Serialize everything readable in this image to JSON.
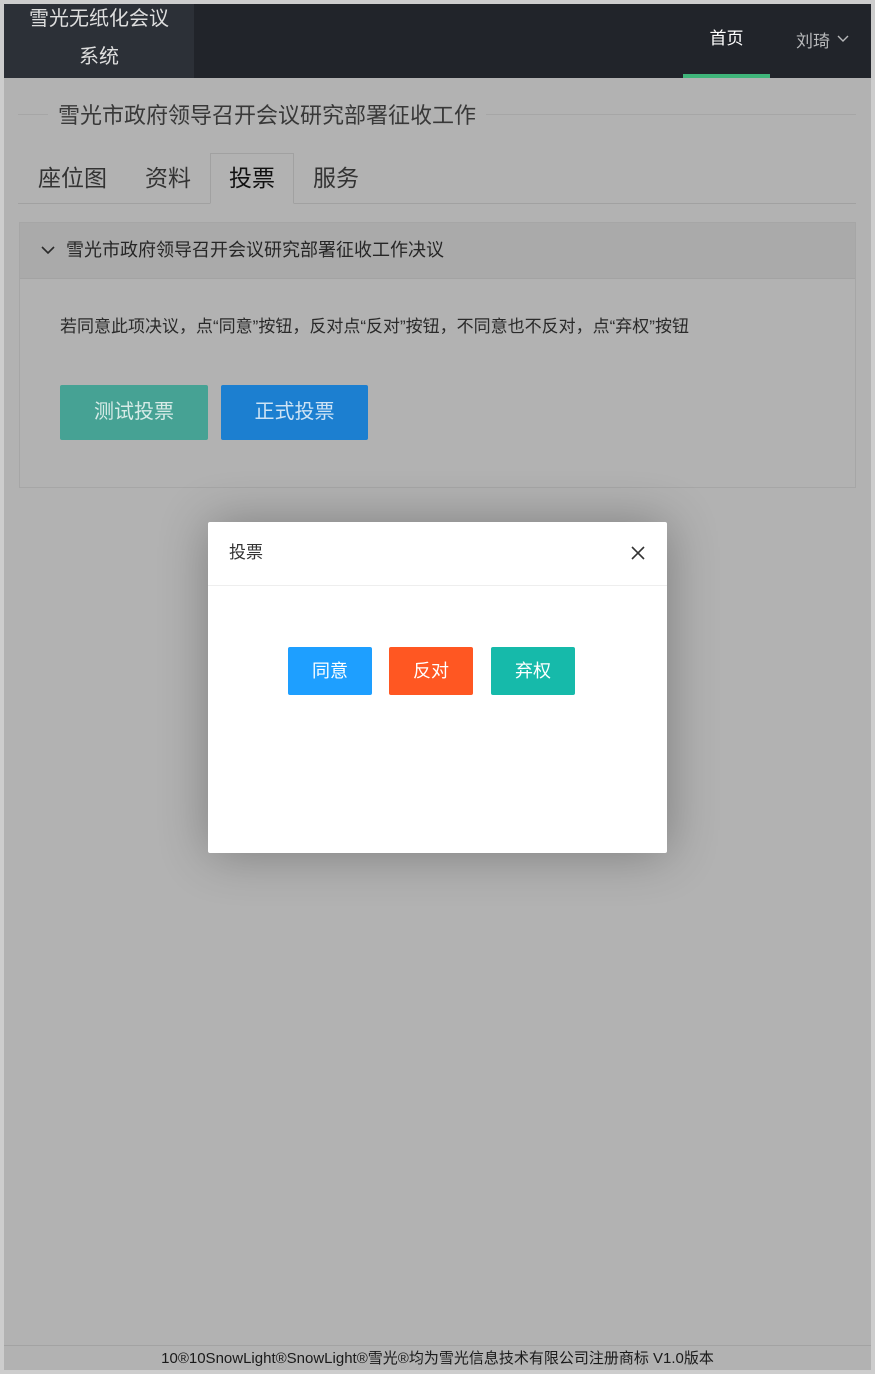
{
  "app": {
    "logo_text": "雪光无纸化会议系统"
  },
  "header": {
    "nav_home_label": "首页",
    "user_name": "刘琦",
    "user_menu_icon": "chevron-down-icon"
  },
  "meeting": {
    "title": "雪光市政府领导召开会议研究部署征收工作"
  },
  "tabs": [
    {
      "label": "座位图",
      "active": false
    },
    {
      "label": "资料",
      "active": false
    },
    {
      "label": "投票",
      "active": true
    },
    {
      "label": "服务",
      "active": false
    }
  ],
  "resolution": {
    "title": "雪光市政府领导召开会议研究部署征收工作决议",
    "expanded": true,
    "toggle_icon": "chevron-down-icon",
    "instruction": "若同意此项决议，点“同意”按钮，反对点“反对”按钮，不同意也不反对，点“弃权”按钮",
    "test_vote_label": "测试投票",
    "formal_vote_label": "正式投票"
  },
  "vote_dialog": {
    "title": "投票",
    "close_icon": "close-icon",
    "agree_label": "同意",
    "oppose_label": "反对",
    "abstain_label": "弃权"
  },
  "footer": {
    "text": "10®10SnowLight®SnowLight®雪光®均为雪光信息技术有限公司注册商标 V1.0版本"
  },
  "colors": {
    "header_bg": "#21242a",
    "nav_active_bar": "#3fb57a",
    "test_vote_button": "#46a294",
    "formal_vote_button": "#1c7fd0",
    "agree_button": "#1e9fff",
    "oppose_button": "#ff5722",
    "abstain_button": "#16baaa"
  }
}
